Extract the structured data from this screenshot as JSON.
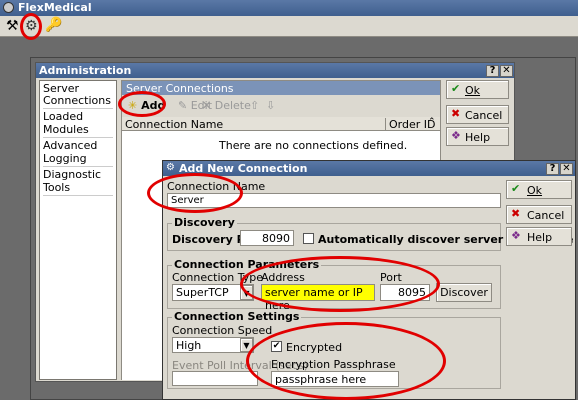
{
  "app": {
    "title": "FlexMedical",
    "toolbar_icons": [
      "tools-icon",
      "network-admin-icon",
      "key-icon"
    ]
  },
  "admin": {
    "title": "Administration",
    "titlebar_buttons": [
      "?",
      "✕"
    ],
    "nav": [
      "Server Connections",
      "Loaded Modules",
      "Advanced Logging",
      "Diagnostic Tools"
    ],
    "panel_title": "Server Connections",
    "toolbar": {
      "add": "Add",
      "edit": "Edit",
      "delete": "Delete"
    },
    "columns": [
      "Connection Name",
      "Order ID"
    ],
    "empty_text": "There are no connections defined.",
    "buttons": {
      "ok": "Ok",
      "cancel": "Cancel",
      "help": "Help"
    }
  },
  "dialog": {
    "title": "Add New Connection",
    "titlebar_buttons": [
      "?",
      "✕"
    ],
    "connection_name_label": "Connection Name",
    "connection_name_value": "Server",
    "discovery": {
      "title": "Discovery",
      "port_label": "Discovery Port",
      "port_value": "8090",
      "auto_label": "Automatically discover server every time",
      "auto_checked": false
    },
    "params": {
      "title": "Connection Parameters",
      "type_label": "Connection Type",
      "type_value": "SuperTCP",
      "address_label": "Address",
      "address_value": "server name or IP here",
      "port_label": "Port",
      "port_value": "8095",
      "discover_button": "Discover"
    },
    "settings": {
      "title": "Connection Settings",
      "speed_label": "Connection Speed",
      "speed_value": "High",
      "poll_label": "Event Poll Interval (secs)",
      "poll_value": "",
      "encrypted_label": "Encrypted",
      "encrypted_checked": true,
      "passphrase_label": "Encryption Passphrase",
      "passphrase_value": "passphrase here"
    },
    "buttons": {
      "ok": "Ok",
      "cancel": "Cancel",
      "help": "Help"
    }
  },
  "colors": {
    "titlebar": "#4a6a9a",
    "window_bg": "#dcd9d0",
    "highlight_field": "#ffff00",
    "annotation_red": "#e10000"
  }
}
